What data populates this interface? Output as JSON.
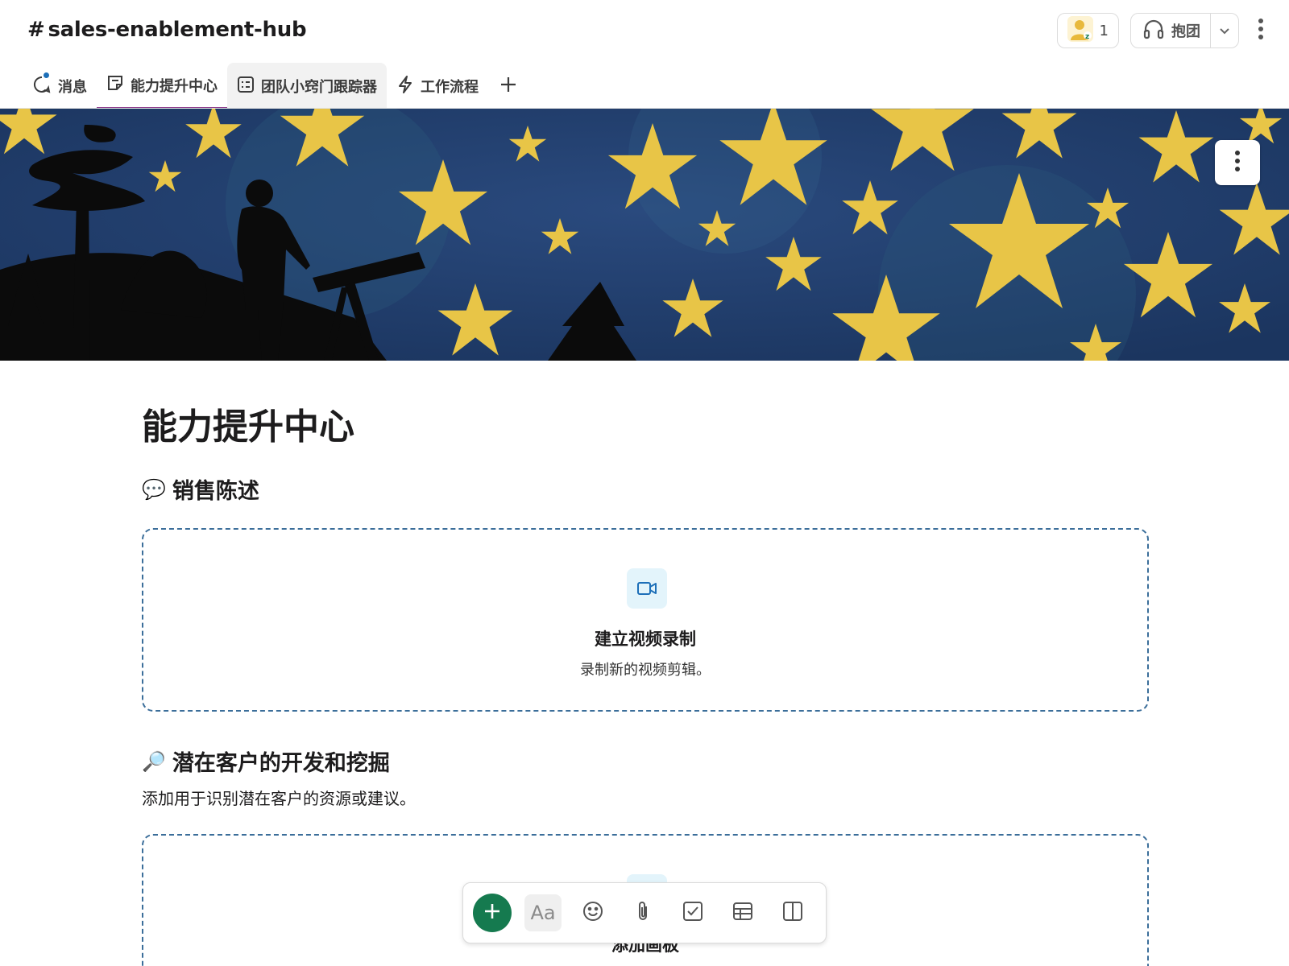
{
  "header": {
    "hash": "#",
    "channel_name": "sales-enablement-hub",
    "member_count": "1",
    "huddle_label": "抱团"
  },
  "tabs": [
    {
      "label": "消息",
      "icon": "message-icon"
    },
    {
      "label": "能力提升中心",
      "icon": "canvas-icon"
    },
    {
      "label": "团队小窍门跟踪器",
      "icon": "list-icon"
    },
    {
      "label": "工作流程",
      "icon": "workflow-icon"
    }
  ],
  "page": {
    "title": "能力提升中心",
    "sections": [
      {
        "emoji": "💬",
        "heading": "销售陈述",
        "placeholder_title": "建立视频录制",
        "placeholder_desc": "录制新的视频剪辑。"
      },
      {
        "emoji": "🔎",
        "heading": "潜在客户的开发和挖掘",
        "description": "添加用于识别潜在客户的资源或建议。",
        "placeholder_title": "添加画板"
      }
    ]
  },
  "toolbar": {
    "text_format_label": "Aa",
    "icons": [
      "plus-icon",
      "text-format-icon",
      "emoji-icon",
      "attachment-icon",
      "checkbox-icon",
      "table-icon",
      "columns-icon"
    ]
  },
  "colors": {
    "accent_tab": "#8e3a8c",
    "notification_dot": "#1d6fb8",
    "add_button": "#157a4f",
    "dashed_border": "#3b6e9a",
    "banner_bg": "#1f3d6b",
    "star": "#e8c547"
  }
}
